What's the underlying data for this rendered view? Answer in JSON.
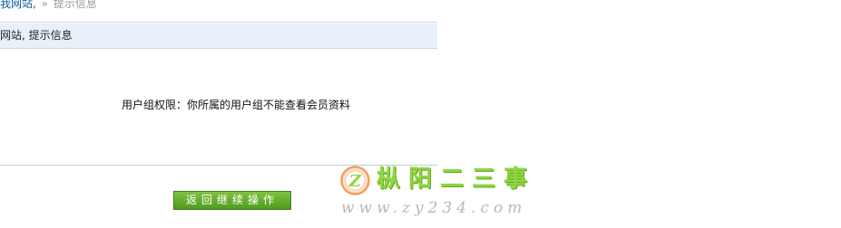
{
  "breadcrumb": {
    "site_link": "我网站,",
    "separator": "»",
    "current": "提示信息"
  },
  "panel": {
    "title": "网站, 提示信息",
    "message": "用户组权限：你所属的用户组不能查看会员资料"
  },
  "back_button": {
    "label": "返回继续操作"
  },
  "watermark": {
    "logo_letter": "Z",
    "title": "枞阳二三事",
    "url": "www.zy234.com"
  },
  "colors": {
    "link": "#0b5f9a",
    "panel_header_bg": "#e8f1f9",
    "button_green": "#5fa82a",
    "watermark_green": "#8fd63f",
    "watermark_orange": "#f0a060"
  }
}
